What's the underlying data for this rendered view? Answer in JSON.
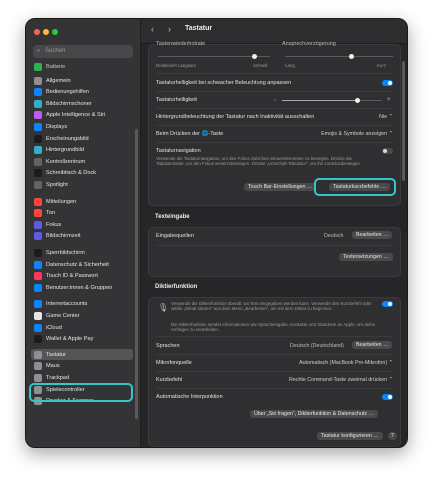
{
  "window": {
    "title": "Tastatur"
  },
  "search": {
    "placeholder": "Suchen"
  },
  "sidebar": {
    "top_partial": "Batterie",
    "items": [
      {
        "label": "Allgemein",
        "icon": "gear-icon",
        "color": "#8e8e93"
      },
      {
        "label": "Bedienungshilfen",
        "icon": "accessibility-icon",
        "color": "#0a84ff"
      },
      {
        "label": "Bildschirmschoner",
        "icon": "screensaver-icon",
        "color": "#30b0c7"
      },
      {
        "label": "Apple Intelligence & Siri",
        "icon": "siri-icon",
        "color": "#bf5af2"
      },
      {
        "label": "Displays",
        "icon": "displays-icon",
        "color": "#0a84ff"
      },
      {
        "label": "Erscheinungsbild",
        "icon": "appearance-icon",
        "color": "#1c1c1e"
      },
      {
        "label": "Hintergrundbild",
        "icon": "wallpaper-icon",
        "color": "#30b0c7"
      },
      {
        "label": "Kontrollzentrum",
        "icon": "control-center-icon",
        "color": "#636366"
      },
      {
        "label": "Schreibtisch & Dock",
        "icon": "dock-icon",
        "color": "#1c1c1e"
      },
      {
        "label": "Spotlight",
        "icon": "spotlight-icon",
        "color": "#636366"
      },
      {
        "label": "Mitteilungen",
        "icon": "notifications-icon",
        "color": "#ff453a"
      },
      {
        "label": "Ton",
        "icon": "sound-icon",
        "color": "#ff453a"
      },
      {
        "label": "Fokus",
        "icon": "focus-icon",
        "color": "#5e5ce6"
      },
      {
        "label": "Bildschirmzeit",
        "icon": "screentime-icon",
        "color": "#5e5ce6"
      },
      {
        "label": "Sperrbildschirm",
        "icon": "lockscreen-icon",
        "color": "#1c1c1e"
      },
      {
        "label": "Datenschutz & Sicherheit",
        "icon": "privacy-icon",
        "color": "#0a84ff"
      },
      {
        "label": "Touch ID & Passwort",
        "icon": "touchid-icon",
        "color": "#ff375f"
      },
      {
        "label": "Benutzer:innen & Gruppen",
        "icon": "users-icon",
        "color": "#0a84ff"
      },
      {
        "label": "Internetaccounts",
        "icon": "internet-accounts-icon",
        "color": "#0a84ff"
      },
      {
        "label": "Game Center",
        "icon": "gamecenter-icon",
        "color": "#e5e5ea"
      },
      {
        "label": "iCloud",
        "icon": "icloud-icon",
        "color": "#0a84ff"
      },
      {
        "label": "Wallet & Apple Pay",
        "icon": "wallet-icon",
        "color": "#1c1c1e"
      },
      {
        "label": "Tastatur",
        "icon": "keyboard-icon",
        "color": "#8e8e93"
      },
      {
        "label": "Maus",
        "icon": "mouse-icon",
        "color": "#8e8e93"
      },
      {
        "label": "Trackpad",
        "icon": "trackpad-icon",
        "color": "#8e8e93"
      },
      {
        "label": "Spielecontroller",
        "icon": "gamecontroller-icon",
        "color": "#8e8e93"
      },
      {
        "label": "Drucker & Scanner",
        "icon": "printer-icon",
        "color": "#8e8e93"
      }
    ]
  },
  "keyboard": {
    "repeat_rate_label": "Tastenwiederholrate",
    "repeat_delay_label": "Ansprechverzögerung",
    "slider1_left": "Deaktiviert",
    "slider1_left2": "Langsam",
    "slider1_right": "Schnell",
    "slider2_left": "Lang",
    "slider2_right": "Kurz",
    "low_light_label": "Tastaturhelligkeit bei schwacher Beleuchtung anpassen",
    "brightness_label": "Tastaturhelligkeit",
    "brightness_level": 0.75,
    "backlight_off_label": "Hintergrundbeleuchtung der Tastatur nach Inaktivität ausschalten",
    "backlight_off_value": "Nie",
    "globe_label": "Beim Drücken der 🌐-Taste",
    "globe_value": "Emojis & Symbole anzeigen",
    "nav_label": "Tastaturnavigation",
    "nav_desc": "Verwende die Tastaturnavigation, um den Fokus zwischen Steuerelementen zu bewegen. Drücke die Tabulatortaste, um den Fokus weiterzubewegen. Drücke „Umschalt-Tabulator“, um ihn zurückzubewegen.",
    "touchbar_button": "Touch Bar-Einstellungen …",
    "shortcuts_button": "Tastaturkurzbefehle …"
  },
  "text_input": {
    "section": "Texteingabe",
    "sources_label": "Eingabequellen",
    "sources_value": "Deutsch",
    "edit_button": "Bearbeiten …",
    "replacements_button": "Textersetzungen …"
  },
  "dictation": {
    "section": "Diktierfunktion",
    "desc1": "Verwende die Diktierfunktion überall, wo Text eingegeben werden kann. Verwende den Kurzbefehl oder wähle „Diktat starten“ aus dem Menü „Bearbeiten“, um mit dem Diktat zu beginnen.",
    "desc2": "Die Diktierfunktion sendet Informationen wie Spracheingabe, Kontakte und Standorte an Apple, um deine Anfragen zu verarbeiten.",
    "languages_label": "Sprachen",
    "languages_value": "Deutsch (Deutschland)",
    "languages_button": "Bearbeiten …",
    "mic_label": "Mikrofonquelle",
    "mic_value": "Automatisch (MacBook Pro-Mikrofon)",
    "shortcut_label": "Kurzbefehl",
    "shortcut_value": "Rechte Command-Taste zweimal drücken",
    "punct_label": "Automatische Interpunktion",
    "about_button": "Über „Siri fragen“, Diktierfunktion & Datenschutz …",
    "setup_button": "Tastatur konfigurieren …",
    "help": "?"
  },
  "colors": {
    "accent": "#0a84ff",
    "highlight": "#35c7c7"
  }
}
